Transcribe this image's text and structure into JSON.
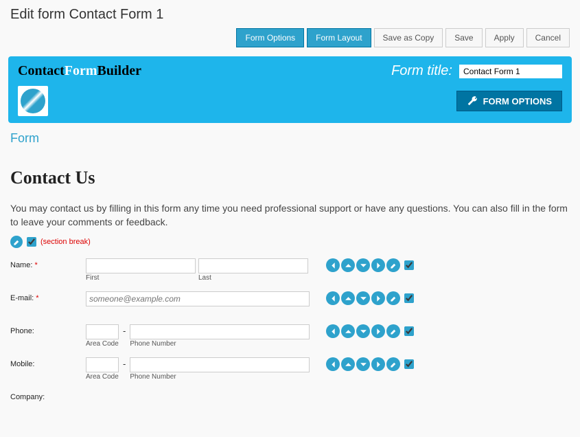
{
  "page": {
    "title": "Edit form Contact Form 1"
  },
  "toolbar": {
    "form_options": "Form Options",
    "form_layout": "Form Layout",
    "save_as_copy": "Save as Copy",
    "save": "Save",
    "apply": "Apply",
    "cancel": "Cancel"
  },
  "brand": {
    "part1": "Contact",
    "part2": "Form",
    "part3": "Builder"
  },
  "form_title": {
    "label": "Form title:",
    "value": "Contact Form 1"
  },
  "form_options_btn": "FORM OPTIONS",
  "tab": "Form",
  "content": {
    "heading": "Contact Us",
    "description": "You may contact us by filling in this form any time you need professional support or have any questions. You can also fill in the form to leave your comments or feedback.",
    "section_break": "(section break)"
  },
  "fields": {
    "name": {
      "label": "Name:",
      "required": "*",
      "sub_first": "First",
      "sub_last": "Last"
    },
    "email": {
      "label": "E-mail:",
      "required": "*",
      "placeholder": "someone@example.com"
    },
    "phone": {
      "label": "Phone:",
      "sub_area": "Area Code",
      "sub_number": "Phone Number",
      "dash": "-"
    },
    "mobile": {
      "label": "Mobile:",
      "sub_area": "Area Code",
      "sub_number": "Phone Number",
      "dash": "-"
    },
    "company": {
      "label": "Company:"
    }
  }
}
